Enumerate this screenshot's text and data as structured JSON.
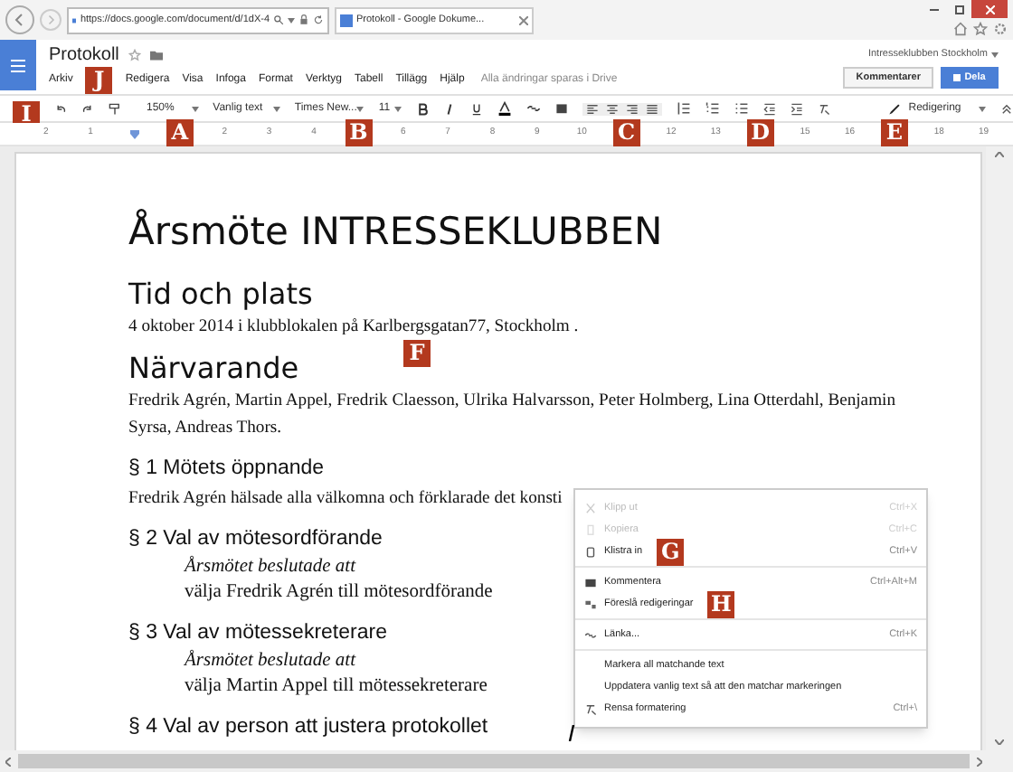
{
  "browser": {
    "address": "https://docs.google.com/document/d/1dX-4",
    "tab_title": "Protokoll - Google Dokume..."
  },
  "doc_header": {
    "title": "Protokoll",
    "account": "Intresseklubben Stockholm",
    "menus": [
      {
        "kind": "menu",
        "label": "Arkiv"
      },
      {
        "kind": "callout",
        "label": "J"
      },
      {
        "kind": "menu",
        "label": "Redigera"
      },
      {
        "kind": "menu",
        "label": "Visa"
      },
      {
        "kind": "menu",
        "label": "Infoga"
      },
      {
        "kind": "menu",
        "label": "Format"
      },
      {
        "kind": "menu",
        "label": "Verktyg"
      },
      {
        "kind": "menu",
        "label": "Tabell"
      },
      {
        "kind": "menu",
        "label": "Tillägg"
      },
      {
        "kind": "menu",
        "label": "Hjälp"
      }
    ],
    "save_status": "Alla ändringar sparas i Drive",
    "comments_button": "Kommentarer",
    "share_button": "Dela"
  },
  "toolbar": {
    "callout": "I",
    "zoom": "150%",
    "style": "Vanlig text",
    "font": "Times New...",
    "size": "11",
    "mode": "Redigering"
  },
  "ruler": [
    {
      "kind": "number",
      "text": "2"
    },
    {
      "kind": "number",
      "text": "1"
    },
    {
      "kind": "marker"
    },
    {
      "kind": "callout",
      "text": "A"
    },
    {
      "kind": "number",
      "text": "2"
    },
    {
      "kind": "number",
      "text": "3"
    },
    {
      "kind": "number",
      "text": "4"
    },
    {
      "kind": "callout",
      "text": "B"
    },
    {
      "kind": "number",
      "text": "6"
    },
    {
      "kind": "number",
      "text": "7"
    },
    {
      "kind": "number",
      "text": "8"
    },
    {
      "kind": "number",
      "text": "9"
    },
    {
      "kind": "number",
      "text": "10"
    },
    {
      "kind": "callout",
      "text": "C"
    },
    {
      "kind": "number",
      "text": "12"
    },
    {
      "kind": "number",
      "text": "13"
    },
    {
      "kind": "callout",
      "text": "D"
    },
    {
      "kind": "number",
      "text": "15"
    },
    {
      "kind": "number",
      "text": "16"
    },
    {
      "kind": "callout",
      "text": "E"
    },
    {
      "kind": "number",
      "text": "18"
    },
    {
      "kind": "number",
      "text": "19"
    }
  ],
  "document": [
    {
      "kind": "title",
      "text": "Årsmöte INTRESSEKLUBBEN"
    },
    {
      "kind": "heading",
      "text": "Tid och plats"
    },
    {
      "kind": "body",
      "text": "4 oktober 2014 i klubblokalen på Karlbergsgatan77, Stockholm ."
    },
    {
      "kind": "callout",
      "text": "F"
    },
    {
      "kind": "heading",
      "text": "Närvarande"
    },
    {
      "kind": "body",
      "text": "Fredrik Agrén, Martin Appel, Fredrik Claesson, Ulrika Halvarsson, Peter Holmberg, Lina Otterdahl, Benjamin Syrsa, Andreas Thors."
    },
    {
      "kind": "section",
      "text": "§ 1 Mötets öppnande"
    },
    {
      "kind": "body",
      "text": "Fredrik Agrén hälsade alla välkomna och förklarade det konsti"
    },
    {
      "kind": "section",
      "text": "§ 2 Val av mötesordförande"
    },
    {
      "kind": "decision",
      "text": "Årsmötet beslutade att"
    },
    {
      "kind": "indent",
      "text": "välja Fredrik Agrén till mötesordförande"
    },
    {
      "kind": "section",
      "text": "§ 3 Val av mötessekreterare"
    },
    {
      "kind": "decision",
      "text": "Årsmötet beslutade att"
    },
    {
      "kind": "indent",
      "text": "välja Martin Appel till mötessekreterare"
    },
    {
      "kind": "section",
      "text": "§ 4 Val av person att justera protokollet"
    }
  ],
  "context_menu": [
    [
      {
        "label": "Klipp ut",
        "shortcut": "Ctrl+X",
        "disabled": true
      },
      {
        "label": "Kopiera",
        "shortcut": "Ctrl+C",
        "disabled": true
      },
      {
        "label": "Klistra in",
        "shortcut": "Ctrl+V",
        "disabled": false,
        "callout": "G"
      }
    ],
    [
      {
        "label": "Kommentera",
        "shortcut": "Ctrl+Alt+M",
        "disabled": false
      },
      {
        "label": "Föreslå redigeringar",
        "disabled": false,
        "callout": "H"
      }
    ],
    [
      {
        "label": "Länka...",
        "shortcut": "Ctrl+K",
        "disabled": false
      }
    ],
    [
      {
        "label": "Markera all matchande text",
        "disabled": false
      },
      {
        "label": "Uppdatera vanlig text så att den matchar markeringen",
        "disabled": false
      },
      {
        "label": "Rensa formatering",
        "shortcut": "Ctrl+\\",
        "disabled": false
      }
    ]
  ]
}
